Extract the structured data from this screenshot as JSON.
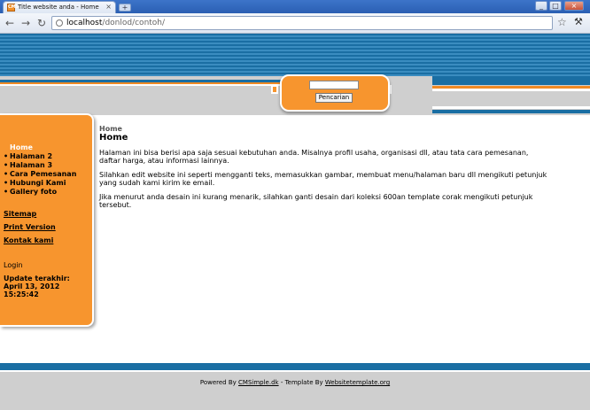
{
  "browser": {
    "tab_title": "Title website anda - Home",
    "tab_close": "×",
    "new_tab": "+",
    "min": "_",
    "max": "□",
    "close": "×",
    "url_host": "localhost",
    "url_path": "/donlod/contoh/"
  },
  "icons": {
    "back": "back-arrow-icon",
    "forward": "forward-arrow-icon",
    "reload": "reload-icon",
    "star": "star-icon",
    "wrench": "wrench-icon"
  },
  "search": {
    "button_label": "Pencarian",
    "value": ""
  },
  "sidebar": {
    "home": "Home",
    "items": [
      "Halaman 2",
      "Halaman 3",
      "Cara Pemesanan",
      "Hubungi Kami",
      "Gallery foto"
    ],
    "sitemap": "Sitemap",
    "print": "Print Version",
    "contact": "Kontak kami",
    "login": "Login",
    "updated_label": "Update terakhir:",
    "updated_date": "April 13, 2012",
    "updated_time": "15:25:42"
  },
  "content": {
    "breadcrumb": "Home",
    "title": "Home",
    "paragraphs": [
      "Halaman ini bisa berisi apa saja sesuai kebutuhan anda. Misalnya profil usaha, organisasi dll, atau tata cara pemesanan, daftar harga, atau informasi lainnya.",
      "Silahkan edit website ini seperti mengganti teks, memasukkan gambar, membuat menu/halaman baru dll mengikuti petunjuk yang sudah kami kirim ke email.",
      "Jika menurut anda desain ini kurang menarik, silahkan ganti desain dari koleksi 600an template corak mengikuti petunjuk tersebut."
    ]
  },
  "footer": {
    "powered_by": "Powered By",
    "cms": "CMSimple.dk",
    "separator": "- Template By",
    "template": "Websitetemplate.org"
  },
  "colors": {
    "orange": "#f7952e",
    "blue": "#1a6ea3",
    "gray": "#cfcfcf"
  }
}
